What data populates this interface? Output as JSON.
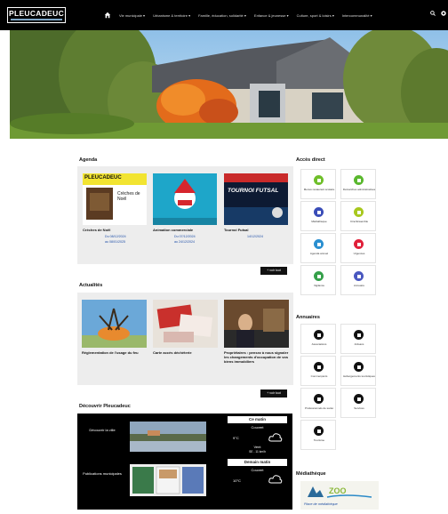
{
  "header": {
    "logo_text": "PLEUCADEUC",
    "nav": [
      "Vie municipale ▾",
      "Urbanisme & territoire ▾",
      "Famille, éducation, solidarité ▾",
      "Enfance & jeunesse ▾",
      "Culture, sport & loisirs ▾",
      "Intercommunalité ▾"
    ]
  },
  "agenda": {
    "title": "Agenda",
    "cards": [
      {
        "title": "Crèches de Noël",
        "poster_brand": "PLEUCADEUC",
        "poster_text": "Crèches de Noël",
        "date1": "Du 08/12/2024",
        "date2": "au 08/01/2025"
      },
      {
        "title": "Animation commerciale",
        "date1": "Du 07/12/2024",
        "date2": "au 24/12/2024"
      },
      {
        "title": "Tournoi Futsal",
        "poster_text": "TOURNOI FUTSAL",
        "date1": "14/12/2024",
        "date2": ""
      }
    ],
    "more_label": "+ voir tout"
  },
  "actualites": {
    "title": "Actualités",
    "cards": [
      {
        "title": "Réglementation de l'usage du feu"
      },
      {
        "title": "Carte accès déchèterie"
      },
      {
        "title": "Propriétaires : pensez à nous signaler les changements d'occupation de vos biens immobiliers"
      }
    ],
    "more_label": "+ voir tout"
  },
  "decouvrir": {
    "title": "Découvrir Pleucadeuc",
    "items": [
      {
        "label": "Découvrir la ville"
      },
      {
        "label": "Publications municipales"
      }
    ],
    "weather": {
      "today_label": "Ce matin",
      "today_sky": "Couvert",
      "today_temp": "9°C",
      "wind_label": "Vent",
      "wind_value": "SE - 11 km/h",
      "tomorrow_label": "Demain matin",
      "tomorrow_sky": "Couvert",
      "tomorrow_temp": "10°C"
    }
  },
  "acces_direct": {
    "title": "Accès direct",
    "tiles": [
      {
        "label": "Menus restaurant scolaire",
        "color": "#6fbf2a"
      },
      {
        "label": "Démarches administratives",
        "color": "#5ab82e"
      },
      {
        "label": "Médiathèque",
        "color": "#3a4db8"
      },
      {
        "label": "Ciné'Ensemble",
        "color": "#a8c81e"
      },
      {
        "label": "Agenda annuel",
        "color": "#2a8fd0"
      },
      {
        "label": "Urgences",
        "color": "#e0203a"
      },
      {
        "label": "Vigilance",
        "color": "#35a04a"
      },
      {
        "label": "Annuaire",
        "color": "#4a58c0"
      }
    ]
  },
  "annuaires": {
    "title": "Annuaires",
    "tiles": [
      {
        "label": "Associations"
      },
      {
        "label": "Artisans"
      },
      {
        "label": "Commerçants"
      },
      {
        "label": "Hébergements touristiques"
      },
      {
        "label": "Professionnels de santé"
      },
      {
        "label": "Services"
      },
      {
        "label": "Tourisme"
      }
    ]
  },
  "mediatheque": {
    "title": "Médiathèque",
    "banner_text": "Place de médiathèque"
  }
}
